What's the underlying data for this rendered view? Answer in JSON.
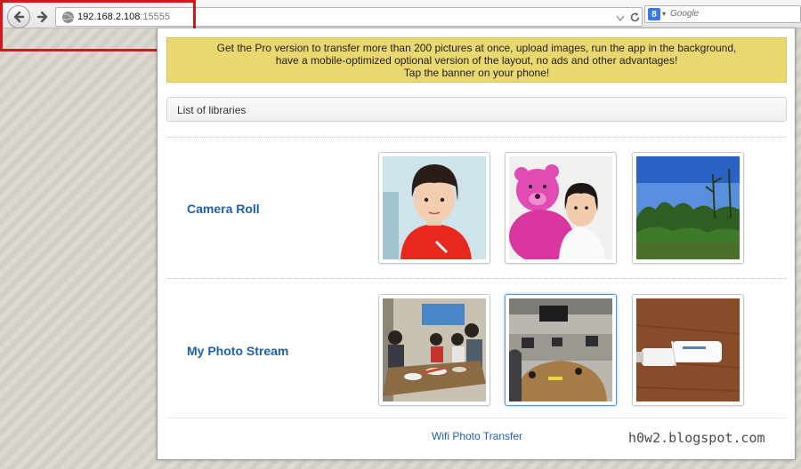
{
  "browser": {
    "url_host": "192.168.2.108",
    "url_port": ":15555",
    "search_placeholder": "Google",
    "search_engine_badge": "8"
  },
  "banner": {
    "line1": "Get the Pro version to transfer more than 200 pictures at once, upload images, run the app in the background,",
    "line2": "have a mobile-optimized optional version of the layout, no ads and other advantages!",
    "line3": "Tap the banner on your phone!"
  },
  "libraries_header": "List of libraries",
  "libraries": [
    {
      "title": "Camera Roll",
      "thumbnails": [
        "girl-red-shirt-photo",
        "girl-pink-teddy-photo",
        "trees-sky-photo"
      ]
    },
    {
      "title": "My Photo Stream",
      "thumbnails": [
        "group-dinner-photo",
        "office-room-photo",
        "usb-modem-photo"
      ]
    }
  ],
  "footer_link": "Wifi Photo Transfer",
  "watermark": "h0w2.blogspot.com",
  "colors": {
    "banner_bg": "#e9d770",
    "link": "#1d5fb0",
    "highlight": "#d8141c"
  }
}
